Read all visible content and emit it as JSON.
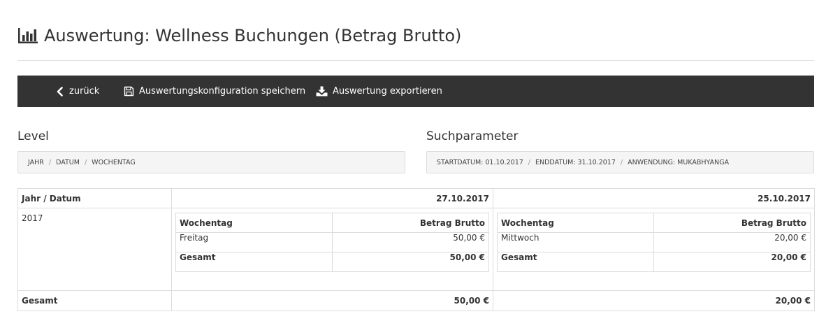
{
  "page": {
    "title": "Auswertung: Wellness Buchungen (Betrag Brutto)",
    "icon": "bar-chart-icon"
  },
  "toolbar": {
    "back_label": "zurück",
    "save_label": "Auswertungskonfiguration speichern",
    "export_label": "Auswertung exportieren"
  },
  "level": {
    "title": "Level",
    "items": [
      "Jahr",
      "Datum",
      "Wochentag"
    ]
  },
  "search": {
    "title": "Suchparameter",
    "items": [
      "Startdatum: 01.10.2017",
      "Enddatum: 31.10.2017",
      "Anwendung: Mukabhyanga"
    ]
  },
  "table": {
    "header_first": "Jahr / Datum",
    "dates": [
      "27.10.2017",
      "25.10.2017"
    ],
    "year": "2017",
    "sub_headers": [
      "Wochentag",
      "Betrag Brutto"
    ],
    "groups": [
      {
        "day": "Freitag",
        "amount": "50,00 €",
        "total_label": "Gesamt",
        "total": "50,00 €"
      },
      {
        "day": "Mittwoch",
        "amount": "20,00 €",
        "total_label": "Gesamt",
        "total": "20,00 €"
      }
    ],
    "footer_label": "Gesamt",
    "footer_totals": [
      "50,00 €",
      "20,00 €"
    ]
  },
  "colors": {
    "toolbar_bg": "#333333",
    "border": "#dcdcdc",
    "crumb_bg": "#f5f5f5"
  }
}
